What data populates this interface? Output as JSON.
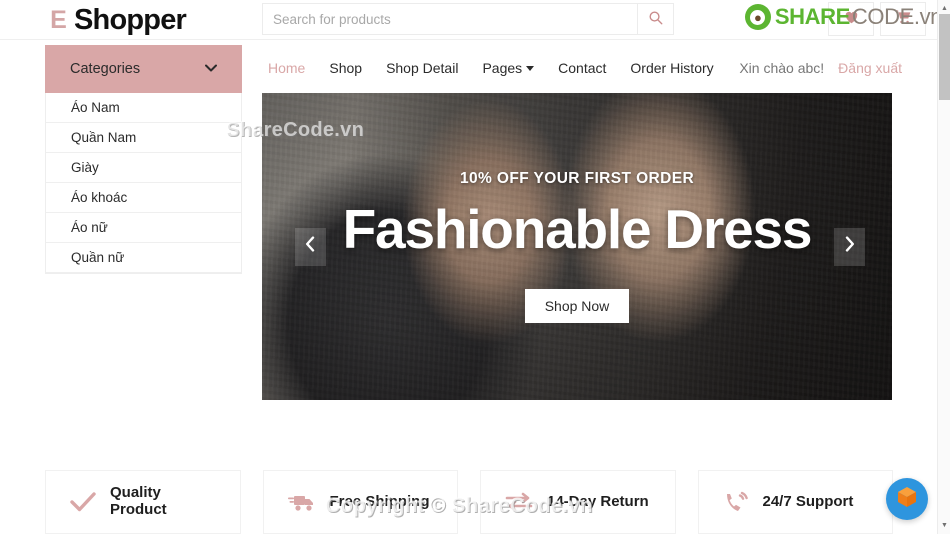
{
  "header": {
    "logo_badge": "E",
    "logo_text": "Shopper",
    "search_placeholder": "Search for products",
    "search_value": "",
    "search_icon": "search-icon",
    "wishlist_icon": "heart-icon",
    "cart_icon": "shopping-cart-icon"
  },
  "sidebar": {
    "toggle_label": "Categories",
    "chevron": "⌄",
    "items": [
      {
        "label": "Áo Nam"
      },
      {
        "label": "Quần Nam"
      },
      {
        "label": "Giày"
      },
      {
        "label": "Áo khoác"
      },
      {
        "label": "Áo nữ"
      },
      {
        "label": "Quần nữ"
      }
    ]
  },
  "nav": {
    "links": [
      {
        "label": "Home",
        "active": true
      },
      {
        "label": "Shop",
        "active": false
      },
      {
        "label": "Shop Detail",
        "active": false
      },
      {
        "label": "Pages",
        "active": false,
        "dropdown": true
      },
      {
        "label": "Contact",
        "active": false
      },
      {
        "label": "Order History",
        "active": false
      }
    ],
    "greeting": "Xin chào abc!",
    "logout_label": "Đăng xuất"
  },
  "hero": {
    "kicker": "10% OFF YOUR FIRST ORDER",
    "title": "Fashionable Dress",
    "cta_label": "Shop Now",
    "prev_icon": "chevron-left-icon",
    "next_icon": "chevron-right-icon"
  },
  "features": [
    {
      "icon": "check-icon",
      "line1": "Quality",
      "line2": "Product"
    },
    {
      "icon": "truck-icon",
      "line1": "Free Shipping",
      "line2": ""
    },
    {
      "icon": "exchange-icon",
      "line1": "14-Day Return",
      "line2": ""
    },
    {
      "icon": "phone-icon",
      "line1": "24/7 Support",
      "line2": ""
    }
  ],
  "watermarks": {
    "hero": "ShareCode.vn",
    "bottom": "Copyright © ShareCode.vn",
    "logo_mark": "●",
    "logo_green": "SHARE",
    "logo_gray": "CODE.vn"
  },
  "chat_widget": {
    "icon": "cube-chat-icon"
  },
  "scrollbar": {
    "up_icon": "▲",
    "down_icon": "▼"
  },
  "colors": {
    "accent": "#D9A7A7",
    "accent_dark": "#C98C8C",
    "text": "#2b2b2b",
    "watermark_green": "#5CB531",
    "chat_blue": "#2e95de",
    "chat_orange": "#f28a1b"
  }
}
